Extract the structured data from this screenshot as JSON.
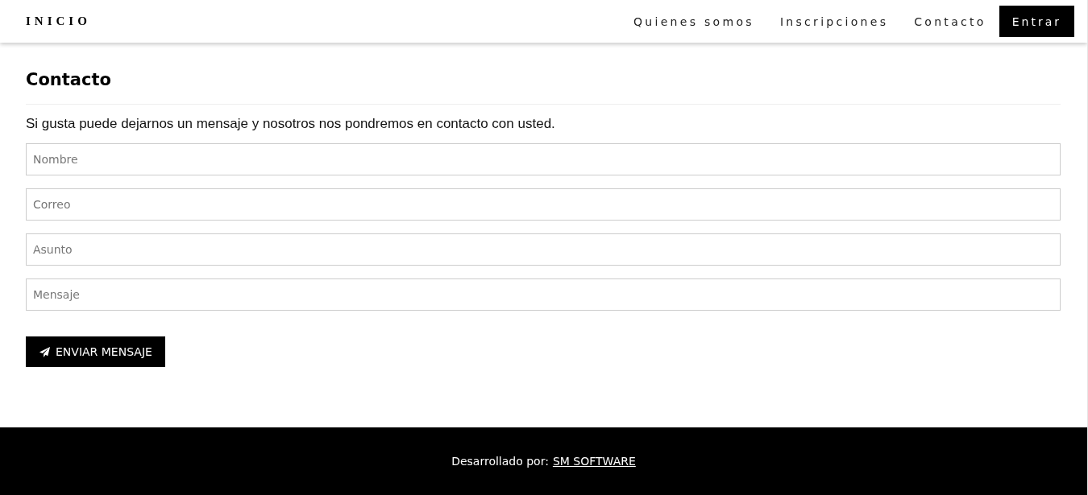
{
  "navbar": {
    "brand": "INICIO",
    "items": [
      {
        "label": "Quienes somos",
        "kind": "link"
      },
      {
        "label": "Inscripciones",
        "kind": "link"
      },
      {
        "label": "Contacto",
        "kind": "link"
      },
      {
        "label": "Entrar",
        "kind": "button"
      }
    ]
  },
  "contact": {
    "title": "Contacto",
    "intro": "Si gusta puede dejarnos un mensaje y nosotros nos pondremos en contacto con usted.",
    "fields": [
      {
        "placeholder": "Nombre"
      },
      {
        "placeholder": "Correo"
      },
      {
        "placeholder": "Asunto"
      },
      {
        "placeholder": "Mensaje"
      }
    ],
    "submit": "ENVIAR MENSAJE"
  },
  "footer": {
    "text": "Desarrollado por:",
    "link": "SM SOFTWARE"
  }
}
